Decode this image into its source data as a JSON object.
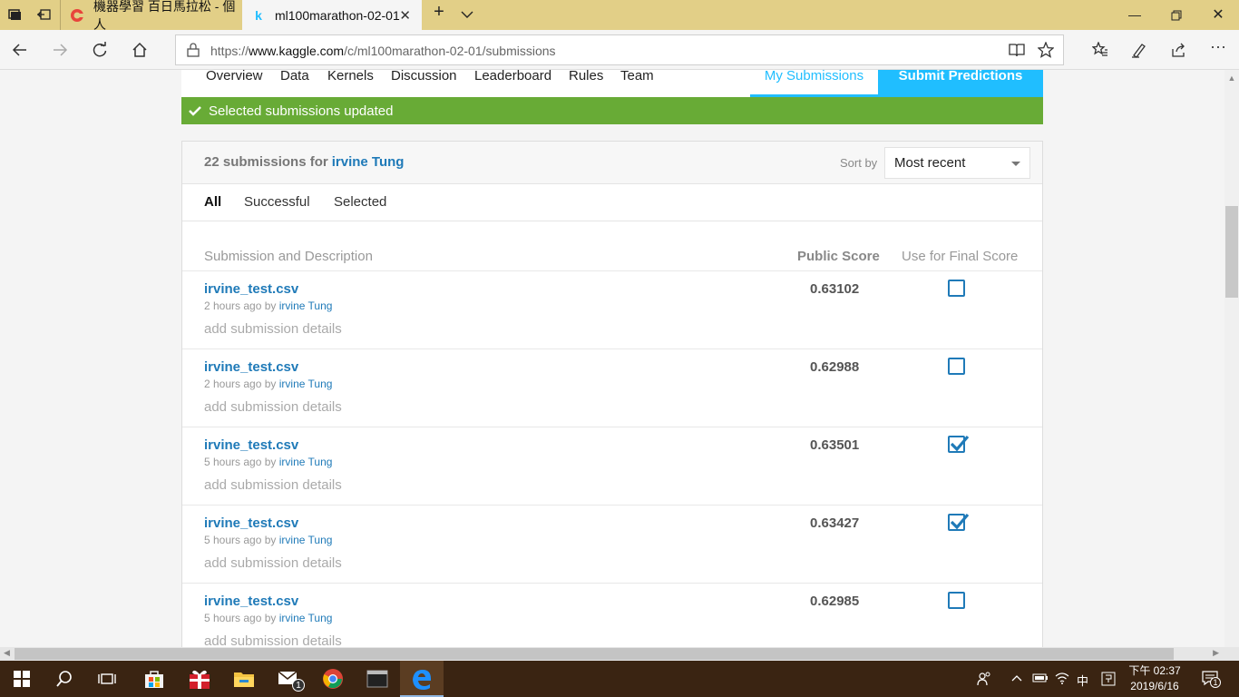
{
  "browser": {
    "tabs": [
      {
        "label": "機器學習 百日馬拉松 - 個人",
        "favicon": "cupoy-icon"
      },
      {
        "label": "ml100marathon-02-01",
        "favicon": "k"
      }
    ],
    "url_prefix": "https://",
    "url_host": "www.kaggle.com",
    "url_path": "/c/ml100marathon-02-01/submissions"
  },
  "competition_nav": {
    "items": [
      "Overview",
      "Data",
      "Kernels",
      "Discussion",
      "Leaderboard",
      "Rules",
      "Team"
    ],
    "my_submissions": "My Submissions",
    "submit_predictions": "Submit Predictions"
  },
  "banner": {
    "text": "Selected submissions updated",
    "color": "#68ab36"
  },
  "submissions_header": {
    "count_text": "22 submissions for",
    "user": "irvine Tung",
    "sort_label": "Sort by",
    "sort_value": "Most recent"
  },
  "filters": [
    "All",
    "Successful",
    "Selected"
  ],
  "columns": {
    "desc": "Submission and Description",
    "score": "Public Score",
    "final": "Use for Final Score"
  },
  "rows": [
    {
      "file": "irvine_test.csv",
      "time": "2 hours ago by",
      "by": "irvine Tung",
      "details": "add submission details",
      "score": "0.63102",
      "selected": false
    },
    {
      "file": "irvine_test.csv",
      "time": "2 hours ago by",
      "by": "irvine Tung",
      "details": "add submission details",
      "score": "0.62988",
      "selected": false
    },
    {
      "file": "irvine_test.csv",
      "time": "5 hours ago by",
      "by": "irvine Tung",
      "details": "add submission details",
      "score": "0.63501",
      "selected": true
    },
    {
      "file": "irvine_test.csv",
      "time": "5 hours ago by",
      "by": "irvine Tung",
      "details": "add submission details",
      "score": "0.63427",
      "selected": true
    },
    {
      "file": "irvine_test.csv",
      "time": "5 hours ago by",
      "by": "irvine Tung",
      "details": "add submission details",
      "score": "0.62985",
      "selected": false
    }
  ],
  "taskbar": {
    "ime": "中",
    "clock_time": "下午 02:37",
    "clock_date": "2019/6/16",
    "mail_badge": "1",
    "notify_badge": "1"
  },
  "colors": {
    "accent": "#20beff",
    "link": "#1f7ab8",
    "titlebar": "#e2cf87",
    "taskbar": "#3a2412"
  }
}
